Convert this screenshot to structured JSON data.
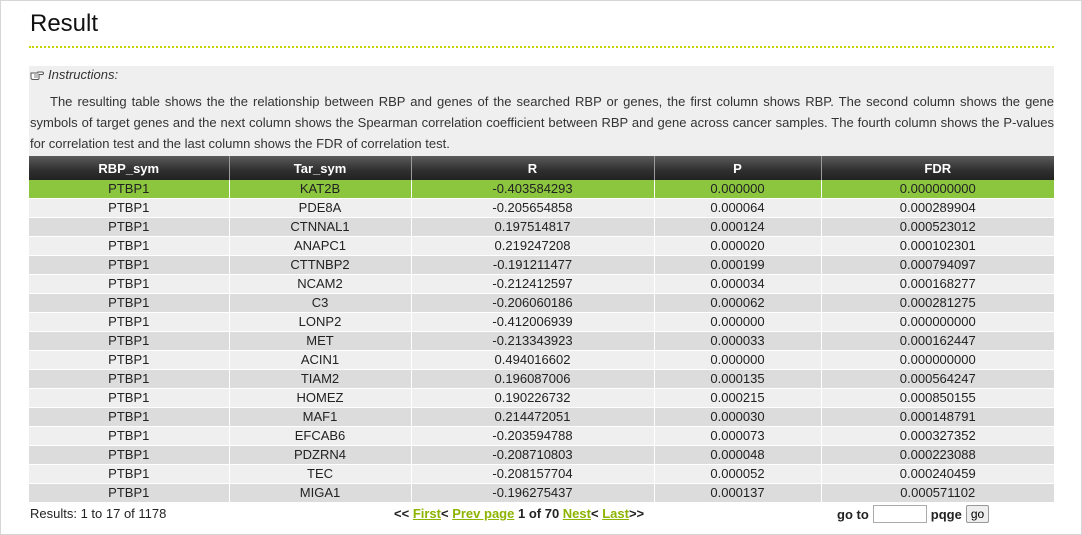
{
  "page": {
    "title": "Result"
  },
  "instructions": {
    "heading": "Instructions:",
    "icon": "pointing-hand-icon",
    "text": "The resulting table shows the the relationship between RBP and genes of the searched RBP or genes, the first column shows RBP. The second column shows the gene symbols of target genes and the next column shows the Spearman correlation coefficient between RBP and gene across cancer samples. The fourth column shows the P-values for correlation test and the last column shows the FDR of correlation test."
  },
  "table": {
    "columns": [
      "RBP_sym",
      "Tar_sym",
      "R",
      "P",
      "FDR"
    ],
    "rows": [
      [
        "PTBP1",
        "KAT2B",
        "-0.403584293",
        "0.000000",
        "0.000000000"
      ],
      [
        "PTBP1",
        "PDE8A",
        "-0.205654858",
        "0.000064",
        "0.000289904"
      ],
      [
        "PTBP1",
        "CTNNAL1",
        "0.197514817",
        "0.000124",
        "0.000523012"
      ],
      [
        "PTBP1",
        "ANAPC1",
        "0.219247208",
        "0.000020",
        "0.000102301"
      ],
      [
        "PTBP1",
        "CTTNBP2",
        "-0.191211477",
        "0.000199",
        "0.000794097"
      ],
      [
        "PTBP1",
        "NCAM2",
        "-0.212412597",
        "0.000034",
        "0.000168277"
      ],
      [
        "PTBP1",
        "C3",
        "-0.206060186",
        "0.000062",
        "0.000281275"
      ],
      [
        "PTBP1",
        "LONP2",
        "-0.412006939",
        "0.000000",
        "0.000000000"
      ],
      [
        "PTBP1",
        "MET",
        "-0.213343923",
        "0.000033",
        "0.000162447"
      ],
      [
        "PTBP1",
        "ACIN1",
        "0.494016602",
        "0.000000",
        "0.000000000"
      ],
      [
        "PTBP1",
        "TIAM2",
        "0.196087006",
        "0.000135",
        "0.000564247"
      ],
      [
        "PTBP1",
        "HOMEZ",
        "0.190226732",
        "0.000215",
        "0.000850155"
      ],
      [
        "PTBP1",
        "MAF1",
        "0.214472051",
        "0.000030",
        "0.000148791"
      ],
      [
        "PTBP1",
        "EFCAB6",
        "-0.203594788",
        "0.000073",
        "0.000327352"
      ],
      [
        "PTBP1",
        "PDZRN4",
        "-0.208710803",
        "0.000048",
        "0.000223088"
      ],
      [
        "PTBP1",
        "TEC",
        "-0.208157704",
        "0.000052",
        "0.000240459"
      ],
      [
        "PTBP1",
        "MIGA1",
        "-0.196275437",
        "0.000137",
        "0.000571102"
      ]
    ],
    "selected_row_index": 0,
    "selected_row_color": "#8cc63f"
  },
  "footer": {
    "results_text": "Results: 1 to 17 of 1178",
    "pager": {
      "open": "<<",
      "first": "First",
      "sep1": "<",
      "prev": "Prev page",
      "current": "1 of 70",
      "next": "Nest",
      "sep2": "<",
      "last": "Last",
      "close": ">>"
    },
    "goto_label": "go to",
    "goto_value": "",
    "page_label": "pqge",
    "go_button": "go"
  },
  "colors": {
    "accent": "#8cb400",
    "rule": "#c8d400"
  }
}
